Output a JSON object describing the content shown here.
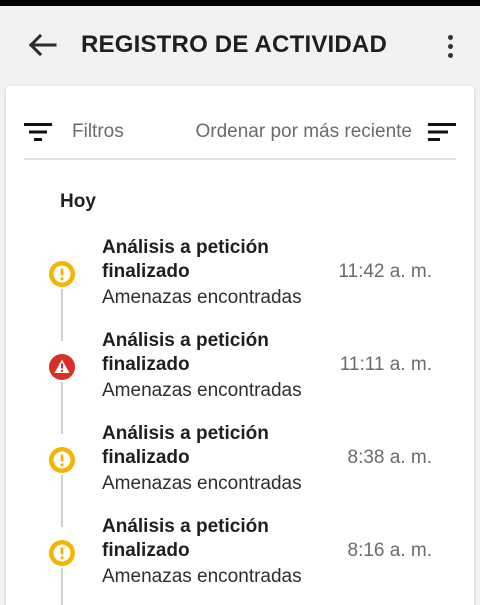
{
  "app_bar": {
    "title": "REGISTRO DE ACTIVIDAD",
    "back_icon": "arrow-left-icon",
    "more_icon": "more-vertical-icon"
  },
  "toolbar": {
    "filters_label": "Filtros",
    "filters_icon": "filter-icon",
    "sort_label": "Ordenar por más reciente",
    "sort_icon": "sort-icon"
  },
  "section": {
    "title": "Hoy"
  },
  "entries": [
    {
      "title": "Análisis a petición finalizado",
      "subtitle": "Amenazas encontradas",
      "time": "11:42 a. m.",
      "severity": "warning"
    },
    {
      "title": "Análisis a petición finalizado",
      "subtitle": "Amenazas encontradas",
      "time": "11:11 a. m.",
      "severity": "critical"
    },
    {
      "title": "Análisis a petición finalizado",
      "subtitle": "Amenazas encontradas",
      "time": "8:38 a. m.",
      "severity": "warning"
    },
    {
      "title": "Análisis a petición finalizado",
      "subtitle": "Amenazas encontradas",
      "time": "8:16 a. m.",
      "severity": "warning"
    }
  ],
  "colors": {
    "warning": "#f4b400",
    "critical": "#d93025",
    "connector": "#d0d0d0"
  }
}
